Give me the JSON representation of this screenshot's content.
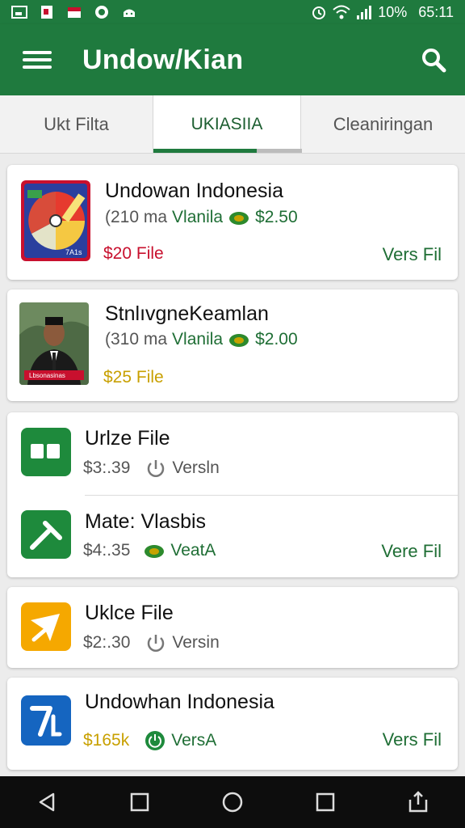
{
  "status_bar": {
    "battery": "10%",
    "time": "65:11",
    "icons": [
      "image-icon",
      "pdf-icon",
      "store-icon",
      "circle-app-icon",
      "android-icon",
      "alarm-icon",
      "wifi-icon",
      "signal-icon"
    ]
  },
  "app_bar": {
    "title": "Undow/Kian",
    "menu_icon": "hamburger-icon",
    "search_icon": "search-icon"
  },
  "tabs": [
    {
      "label": "Ukt Filta",
      "active": false
    },
    {
      "label": "UKIASIIA",
      "active": true
    },
    {
      "label": "Cleaniringan",
      "active": false
    }
  ],
  "items": [
    {
      "title": "Undowan Indonesia",
      "meta_prefix": "(210 ma",
      "meta_tag": "Vlanila",
      "meta_price": "$2.50",
      "price": "$20 File",
      "action": "Vers Fil",
      "thumb_caption": "7A1s"
    },
    {
      "title": "StnlıvgneKeamlan",
      "meta_prefix": "(310 ma",
      "meta_tag": "Vlanila",
      "meta_price": "$2.00",
      "price": "$25 File",
      "thumb_caption": "Lbsonasinas"
    },
    {
      "title": "Urlze File",
      "meta_price": "$3:.39",
      "meta_tag": "Versln"
    },
    {
      "title": "Mate: Vlasbis",
      "meta_price": "$4:.35",
      "meta_tag": "VeatA",
      "action": "Vere Fil"
    },
    {
      "title": "Uklce File",
      "meta_price": "$2:.30",
      "meta_tag": "Versin"
    },
    {
      "title": "Undowhan Indonesia",
      "meta_price": "$165k",
      "meta_tag": "VersA",
      "action": "Vers Fil"
    }
  ],
  "nav_bar": {
    "icons": [
      "back-icon",
      "recents-square-icon",
      "home-circle-icon",
      "overview-square-icon",
      "share-icon"
    ]
  },
  "colors": {
    "primary": "#1f7a3e",
    "accent_green": "#1f6e35",
    "price_red": "#c8102e",
    "price_gold": "#c8a000",
    "icon_green": "#1e8a3c",
    "icon_yellow": "#f5a800",
    "icon_blue": "#1565c0"
  }
}
